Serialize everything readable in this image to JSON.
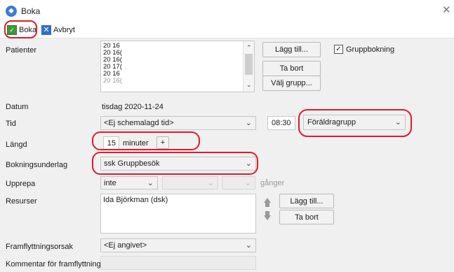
{
  "window": {
    "title": "Boka"
  },
  "toolbar": {
    "book_label": "Boka",
    "cancel_label": "Avbryt"
  },
  "labels": {
    "patients": "Patienter",
    "date": "Datum",
    "time": "Tid",
    "length": "Längd",
    "booking_basis": "Bokningsunderlag",
    "repeat": "Upprepa",
    "resources": "Resurser",
    "postpone_reason": "Framflyttningsorsak",
    "postpone_comment": "Kommentar för framflyttning"
  },
  "patients": {
    "rows": [
      "20 16",
      "20 16(",
      "20 16(",
      "20 17(",
      "20 16",
      "20 16("
    ],
    "add_label": "Lägg till...",
    "remove_label": "Ta bort",
    "choose_group_label": "Välj grupp...",
    "group_booking_label": "Gruppbokning",
    "group_booking_checked": true
  },
  "date": {
    "value": "tisdag  2020-11-24"
  },
  "time": {
    "slot": "<Ej schemalagd tid>",
    "clock": "08:30",
    "type": "Föräldragrupp"
  },
  "length": {
    "value": "15",
    "unit": "minuter",
    "plus_label": "+"
  },
  "booking_basis": {
    "value": "ssk Gruppbesök"
  },
  "repeat": {
    "mode": "inte",
    "times_label": "gånger"
  },
  "resources": {
    "items": [
      "Ida Björkman (dsk)"
    ],
    "add_label": "Lägg till...",
    "remove_label": "Ta bort"
  },
  "postpone": {
    "reason": "<Ej angivet>"
  },
  "colors": {
    "highlight_ring": "#e0192d",
    "form_bg": "#f0f0f0",
    "accent": "#2d6fc6"
  }
}
